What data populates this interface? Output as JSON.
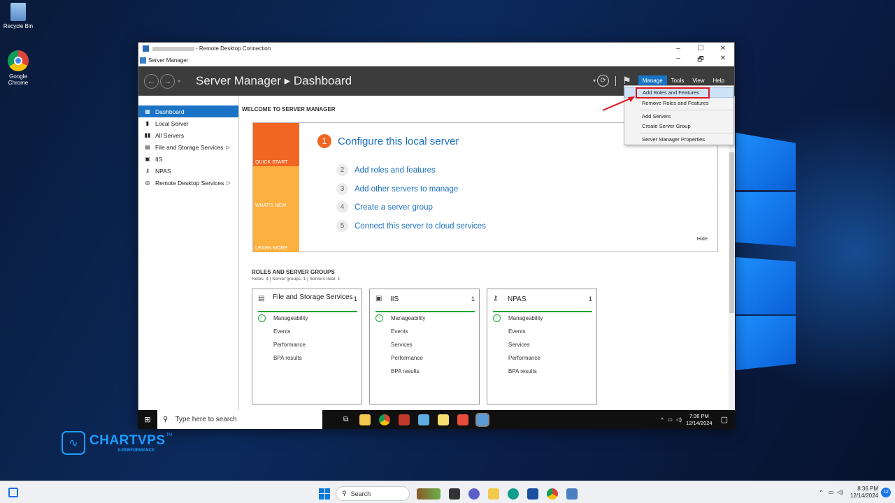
{
  "desktop": {
    "icons": [
      {
        "label": "Recycle Bin"
      },
      {
        "label": "Google Chrome"
      }
    ]
  },
  "rdp": {
    "title": "- Remote Desktop Connection",
    "app_title": "Server Manager",
    "controls": {
      "min": "–",
      "max": "☐",
      "close": "✕",
      "max2": "🗗"
    }
  },
  "header": {
    "title": "Server Manager ▸ Dashboard",
    "menus": [
      "Manage",
      "Tools",
      "View",
      "Help"
    ]
  },
  "sidebar": {
    "items": [
      "Dashboard",
      "Local Server",
      "All Servers",
      "File and Storage Services",
      "IIS",
      "NPAS",
      "Remote Desktop Services"
    ]
  },
  "main": {
    "welcome": "WELCOME TO SERVER MANAGER",
    "tiles": [
      "QUICK START",
      "WHAT'S NEW",
      "LEARN MORE"
    ],
    "configure": {
      "num": "1",
      "text": "Configure this local server"
    },
    "steps": [
      {
        "num": "2",
        "text": "Add roles and features"
      },
      {
        "num": "3",
        "text": "Add other servers to manage"
      },
      {
        "num": "4",
        "text": "Create a server group"
      },
      {
        "num": "5",
        "text": "Connect this server to cloud services"
      }
    ],
    "hide": "Hide",
    "roles_title": "ROLES AND SERVER GROUPS",
    "roles_sub": "Roles: 4  |  Server groups: 1  |  Servers total: 1",
    "cards": [
      {
        "name": "File and Storage Services",
        "count": "1",
        "lines": [
          "Manageability",
          "Events",
          "Performance",
          "BPA results"
        ]
      },
      {
        "name": "IIS",
        "count": "1",
        "lines": [
          "Manageability",
          "Events",
          "Services",
          "Performance",
          "BPA results"
        ]
      },
      {
        "name": "NPAS",
        "count": "1",
        "lines": [
          "Manageability",
          "Events",
          "Services",
          "Performance",
          "BPA results"
        ]
      }
    ]
  },
  "dropdown": {
    "items": [
      "Add Roles and Features",
      "Remove Roles and Features",
      "Add Servers",
      "Create Server Group",
      "Server Manager Properties"
    ]
  },
  "inner_taskbar": {
    "search": "Type here to search",
    "time": "7:36 PM",
    "date": "12/14/2024"
  },
  "brand": {
    "name": "CHARTVPS",
    "tm": "TM",
    "sub": "X-PERFORMANCE"
  },
  "outer_taskbar": {
    "search": "Search",
    "time": "8:36 PM",
    "date": "12/14/2024",
    "badge": "12"
  }
}
